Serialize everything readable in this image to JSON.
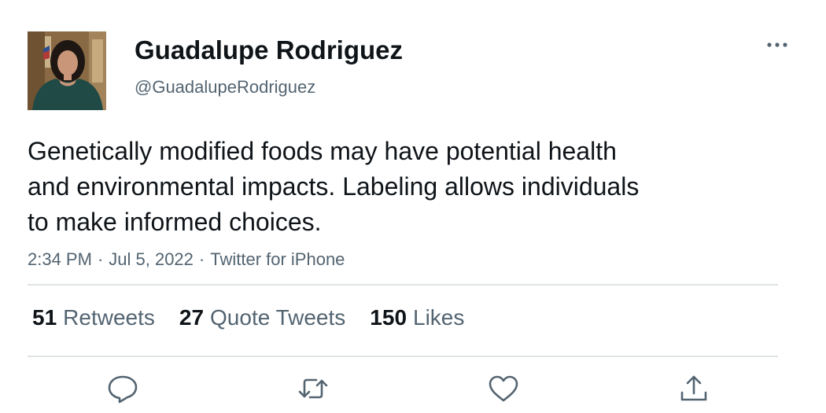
{
  "author": {
    "display_name": "Guadalupe Rodriguez",
    "handle": "@GuadalupeRodriguez",
    "avatar_icon": "profile-photo"
  },
  "tweet": {
    "lines": [
      "Genetically modified foods may have potential health",
      "and environmental impacts. Labeling allows individuals",
      "to make informed choices."
    ]
  },
  "meta": {
    "time": "2:34 PM",
    "date": "Jul 5, 2022",
    "source": "Twitter for iPhone",
    "separator": "·"
  },
  "stats": {
    "retweets": {
      "count": "51",
      "label": "Retweets"
    },
    "quote_tweets": {
      "count": "27",
      "label": "Quote Tweets"
    },
    "likes": {
      "count": "150",
      "label": "Likes"
    }
  },
  "actions": {
    "reply_icon": "reply-icon",
    "retweet_icon": "retweet-icon",
    "like_icon": "heart-icon",
    "share_icon": "share-icon",
    "more_icon": "more-dots-icon"
  },
  "colors": {
    "primary_text": "#0f1419",
    "secondary_text": "#536471",
    "divider": "#dfe3e6",
    "icon": "#536471"
  }
}
